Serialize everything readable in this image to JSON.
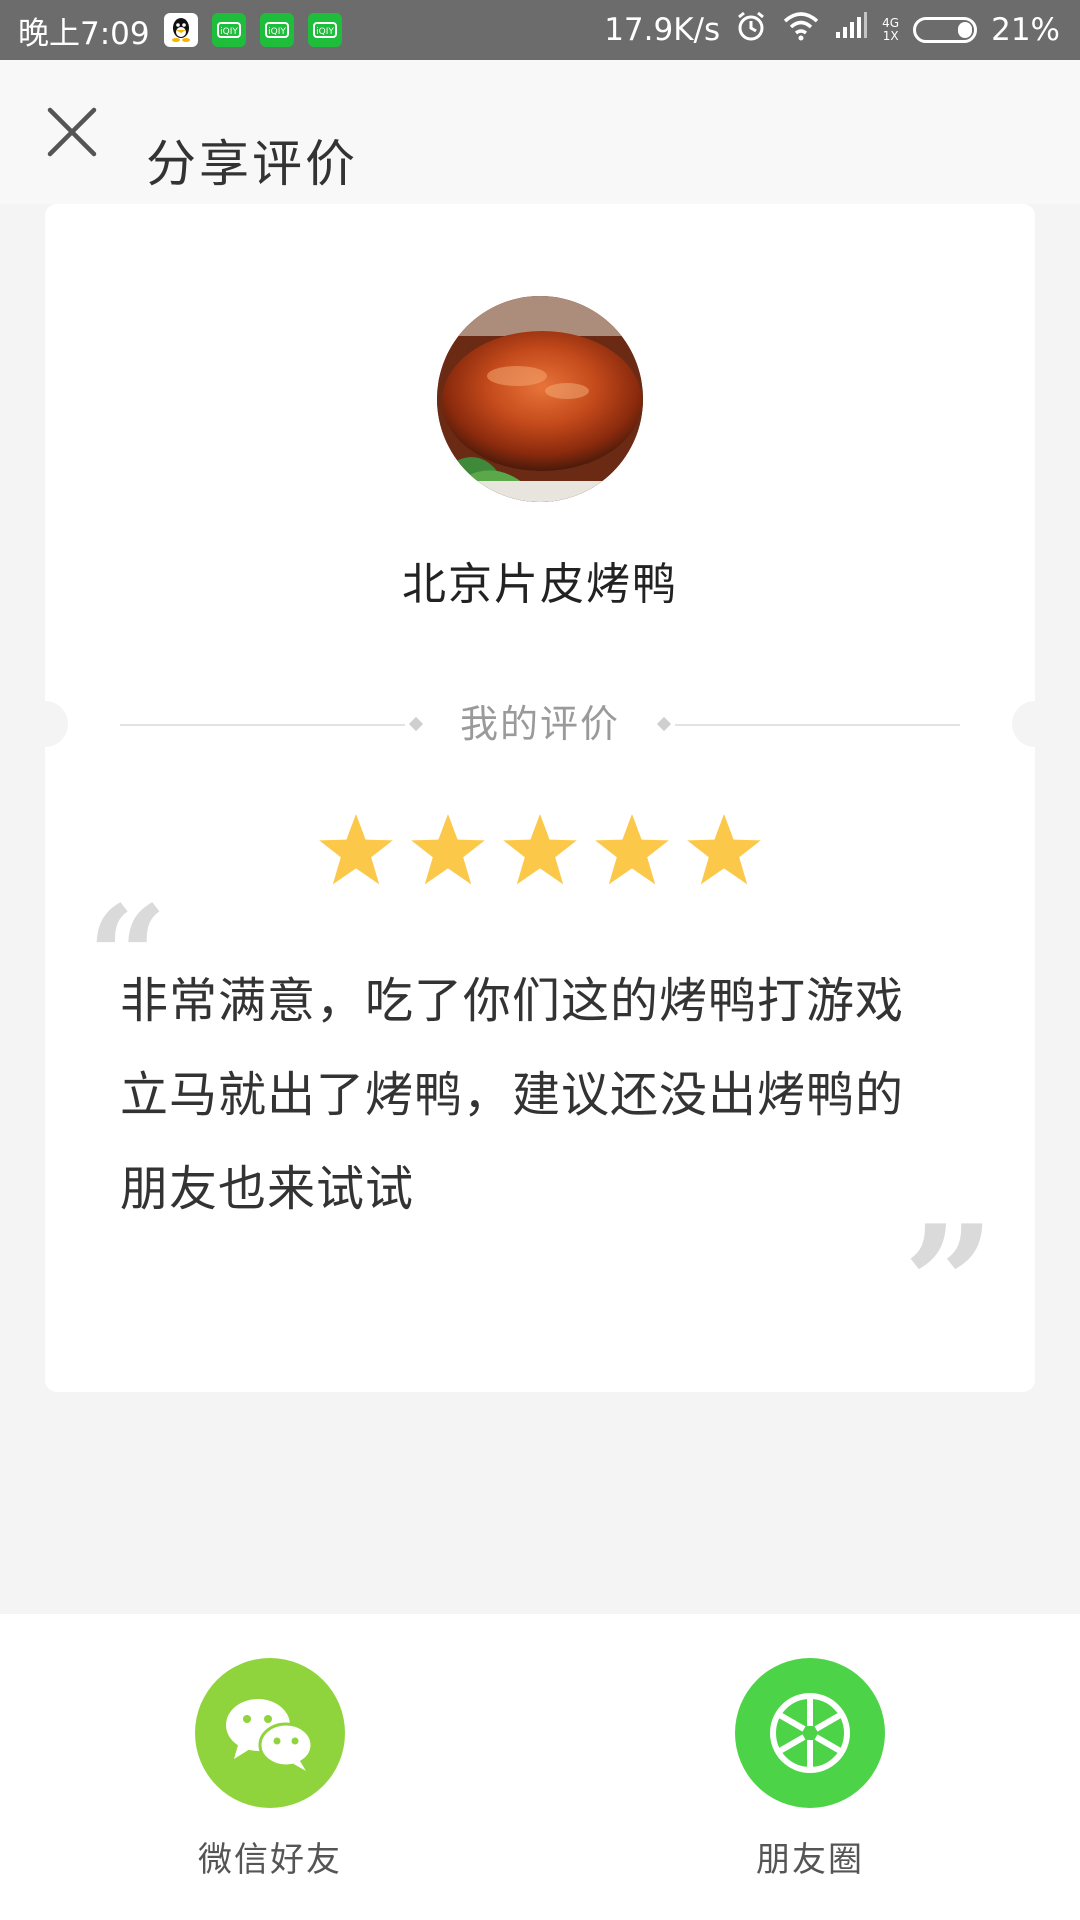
{
  "status_bar": {
    "time": "晚上7:09",
    "net_speed": "17.9K/s",
    "network_type_top": "4G",
    "network_type_bottom": "1X",
    "battery_percent": "21%",
    "battery_level": 0.21,
    "apps": [
      "qq-icon",
      "iqiyi-icon",
      "iqiyi-icon",
      "iqiyi-icon"
    ]
  },
  "header": {
    "title": "分享评价",
    "close_icon": "close-icon"
  },
  "card": {
    "dish_name": "北京片皮烤鸭",
    "section_label": "我的评价",
    "rating": 5,
    "rating_max": 5,
    "open_quote": "“",
    "close_quote": "”",
    "review": "非常满意，吃了你们这的烤鸭打游戏立马就出了烤鸭，建议还没出烤鸭的朋友也来试试"
  },
  "share": {
    "wechat_label": "微信好友",
    "moments_label": "朋友圈"
  },
  "colors": {
    "star": "#fcc84a",
    "wechat": "#8fd43c",
    "moments": "#4cd347",
    "status_bar": "#6c6c6c"
  }
}
